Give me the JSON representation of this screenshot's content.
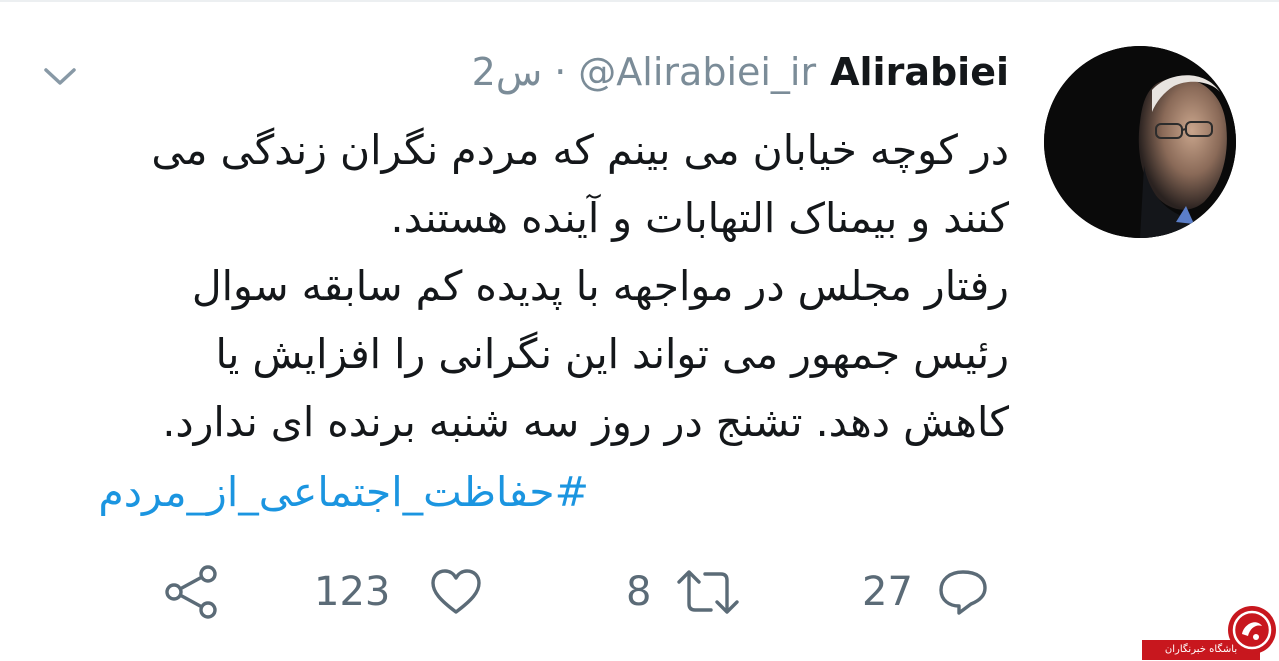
{
  "tweet": {
    "display_name": "Alirabiei",
    "handle": "@Alirabiei_ir",
    "separator": "·",
    "time": "2س",
    "body_lines": [
      "در کوچه خیابان می بینم که مردم نگران زندگی می",
      "کنند و بیمناک التهابات و آینده هستند.",
      "رفتار مجلس در مواجهه با پدیده کم سابقه سوال",
      "رئیس جمهور می تواند این نگرانی را افزایش یا",
      "کاهش دهد. تشنج در روز سه شنبه برنده ای ندارد."
    ],
    "hashtag": "#حفاظت_اجتماعی_از_مردم"
  },
  "actions": {
    "reply_count": "27",
    "retweet_count": "8",
    "like_count": "123",
    "icons": [
      "reply-icon",
      "retweet-icon",
      "like-icon",
      "share-icon"
    ]
  },
  "colors": {
    "text": "#14171a",
    "muted": "#7b8c98",
    "link": "#1b95e0",
    "icon": "#5b6b77",
    "watermark_red": "#c8171e"
  },
  "watermark": {
    "label": "باشگاه خبرنگاران"
  }
}
